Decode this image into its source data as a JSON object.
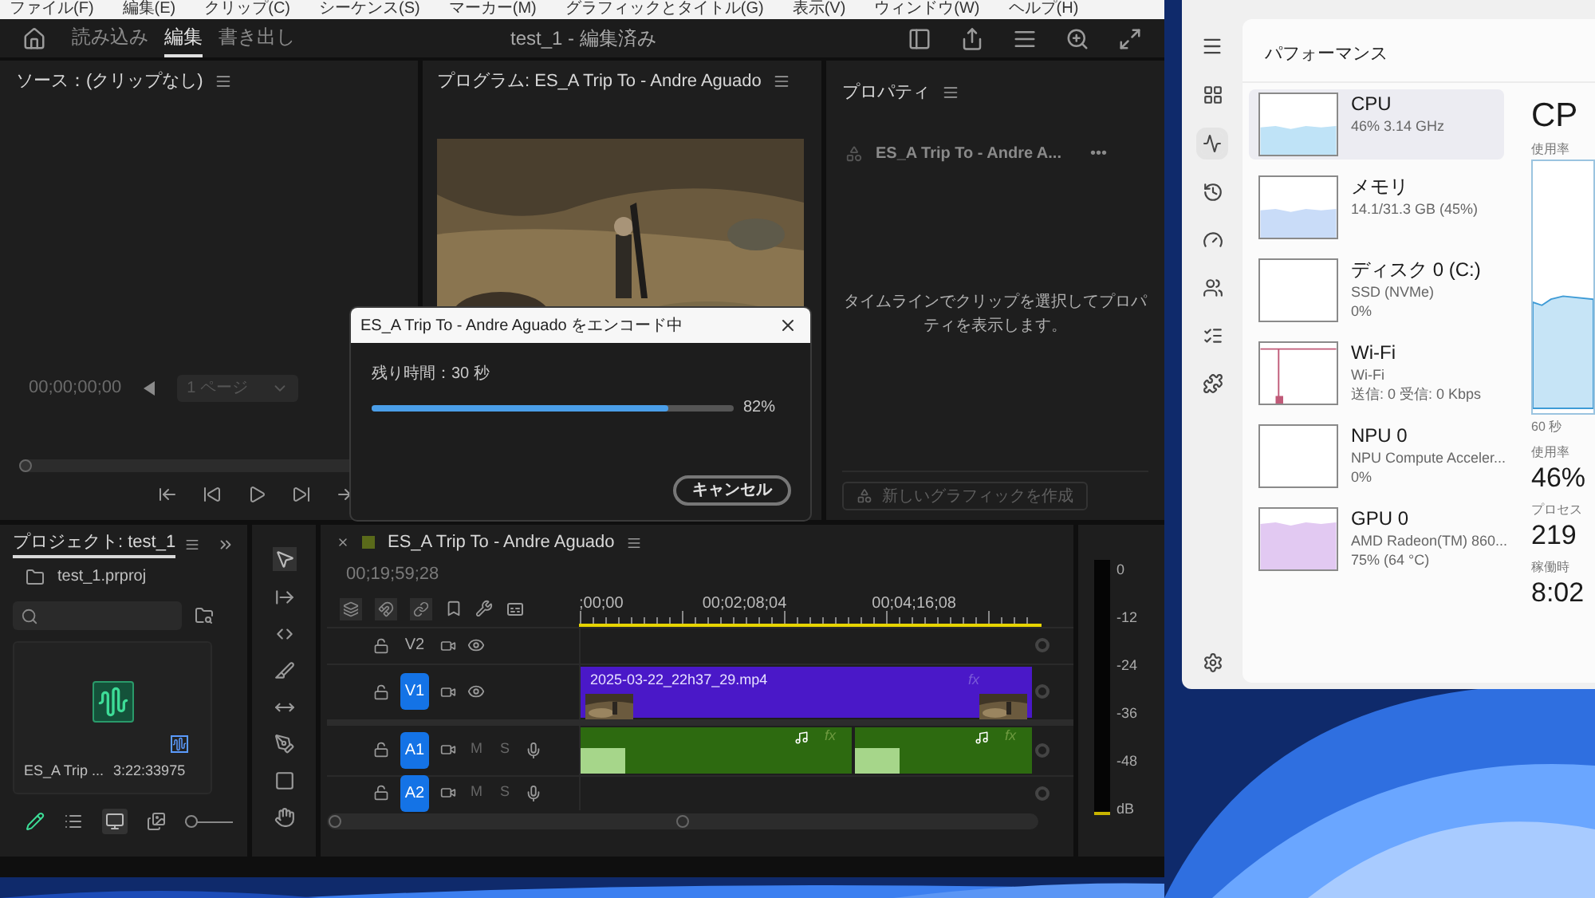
{
  "menu_bar": [
    "ファイル(F)",
    "編集(E)",
    "クリップ(C)",
    "シーケンス(S)",
    "マーカー(M)",
    "グラフィックとタイトル(G)",
    "表示(V)",
    "ウィンドウ(W)",
    "ヘルプ(H)"
  ],
  "header": {
    "tabs": [
      {
        "label": "読み込み",
        "selected": false
      },
      {
        "label": "編集",
        "selected": true
      },
      {
        "label": "書き出し",
        "selected": false
      }
    ],
    "title": "test_1 - 編集済み"
  },
  "source_panel": {
    "title": "ソース：(クリップなし)",
    "timecode": "00;00;00;00",
    "page_select": {
      "value": "1 ページ",
      "disabled": true
    }
  },
  "program_panel": {
    "title": "プログラム: ES_A Trip To - Andre Aguado"
  },
  "properties_panel": {
    "title": "プロパティ",
    "clip_name": "ES_A Trip To - Andre A...",
    "more": "•••",
    "message": "タイムラインでクリップを選択してプロパティを表示します。",
    "new_graphic_button": {
      "label": "新しいグラフィックを作成",
      "disabled": true
    }
  },
  "encode_dialog": {
    "title": "ES_A Trip To - Andre Aguado をエンコード中",
    "remaining": "残り時間：30 秒",
    "level": 0.82,
    "percent": "82%",
    "cancel": "キャンセル"
  },
  "project_panel": {
    "title": "プロジェクト: test_1",
    "file": "test_1.prproj",
    "item": {
      "name": "ES_A Trip ...",
      "duration": "3:22:33975"
    },
    "zoom_slider": {
      "level": 0
    }
  },
  "timeline": {
    "title": "ES_A Trip To - Andre Aguado",
    "timecode": "00;19;59;28",
    "ruler": [
      ";00;00",
      "00;02;08;04",
      "00;04;16;08"
    ],
    "tracks": [
      {
        "kind": "video",
        "label": "V2",
        "targeted": false
      },
      {
        "kind": "video",
        "label": "V1",
        "targeted": true,
        "clip": {
          "name": "2025-03-22_22h37_29.mp4",
          "fx": "fx"
        }
      },
      {
        "kind": "audio",
        "label": "A1",
        "targeted": true,
        "mute": "M",
        "solo": "S",
        "clips": [
          {
            "fx": "fx"
          },
          {
            "fx": "fx"
          }
        ]
      },
      {
        "kind": "audio",
        "label": "A2",
        "targeted": true,
        "mute": "M",
        "solo": "S"
      }
    ]
  },
  "audio_meter": {
    "labels": [
      "0",
      "-12",
      "-24",
      "-36",
      "-48",
      "dB"
    ]
  },
  "task_manager": {
    "title": "パフォーマンス",
    "items": [
      {
        "name": "CPU",
        "lines": [
          "46% 3.14 GHz"
        ],
        "selected": true,
        "kind": "low_area",
        "color": "#bfe3f7"
      },
      {
        "name": "メモリ",
        "lines": [
          "14.1/31.3 GB (45%)"
        ],
        "selected": false,
        "kind": "low_area",
        "color": "#c9dcf8"
      },
      {
        "name": "ディスク 0 (C:)",
        "lines": [
          "SSD (NVMe)",
          "0%"
        ],
        "selected": false,
        "kind": "empty"
      },
      {
        "name": "Wi-Fi",
        "lines": [
          "Wi-Fi",
          "送信: 0 受信: 0 Kbps"
        ],
        "selected": false,
        "kind": "spike",
        "color": "#c05a78"
      },
      {
        "name": "NPU 0",
        "lines": [
          "NPU Compute Acceler...",
          "0%"
        ],
        "selected": false,
        "kind": "empty"
      },
      {
        "name": "GPU 0",
        "lines": [
          "AMD Radeon(TM) 860...",
          "75% (64 °C)"
        ],
        "selected": false,
        "kind": "high_area",
        "color": "#e2c9f2"
      }
    ],
    "detail": {
      "title": "CP",
      "usage_label": "使用率",
      "axis_label": "60 秒",
      "stats": [
        {
          "label": "使用率",
          "value": "46%"
        },
        {
          "label": "プロセス",
          "value": "219"
        },
        {
          "label": "稼働時",
          "value": "8:02"
        }
      ]
    }
  }
}
